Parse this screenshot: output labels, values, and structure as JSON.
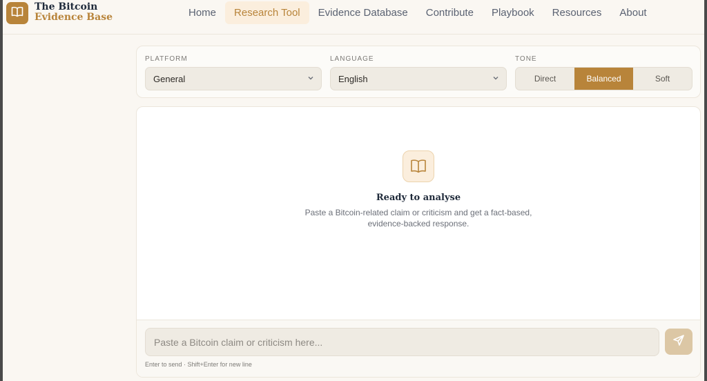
{
  "brand": {
    "line1": "The Bitcoin",
    "line2": "Evidence Base",
    "icon": "book-icon",
    "accent_color": "#b8843a"
  },
  "nav": {
    "items": [
      {
        "label": "Home",
        "active": false
      },
      {
        "label": "Research Tool",
        "active": true
      },
      {
        "label": "Evidence Database",
        "active": false
      },
      {
        "label": "Contribute",
        "active": false
      },
      {
        "label": "Playbook",
        "active": false
      },
      {
        "label": "Resources",
        "active": false
      },
      {
        "label": "About",
        "active": false
      }
    ]
  },
  "controls": {
    "platform": {
      "label": "PLATFORM",
      "value": "General"
    },
    "language": {
      "label": "LANGUAGE",
      "value": "English"
    },
    "tone": {
      "label": "TONE",
      "options": [
        "Direct",
        "Balanced",
        "Soft"
      ],
      "selected": "Balanced"
    }
  },
  "empty_state": {
    "icon": "open-book-icon",
    "title": "Ready to analyse",
    "description": "Paste a Bitcoin-related claim or criticism and get a fact-based, evidence-backed response."
  },
  "composer": {
    "placeholder": "Paste a Bitcoin claim or criticism here...",
    "hint": "Enter to send · Shift+Enter for new line",
    "send_icon": "send-icon"
  }
}
